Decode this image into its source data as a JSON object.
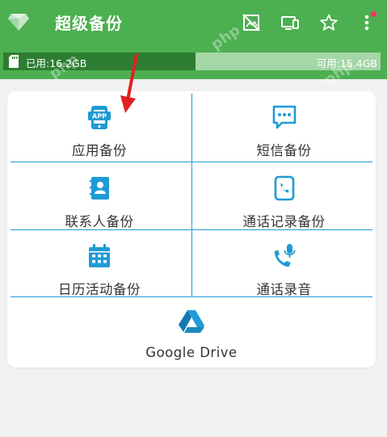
{
  "app": {
    "title": "超级备份"
  },
  "toolbar": {
    "icons": [
      "no-screenshot-icon",
      "cast-screen-icon",
      "star-icon",
      "more-vert-icon"
    ],
    "notification_dot_color": "#ff3366"
  },
  "storage": {
    "used_label": "已用:16.2GB",
    "free_label": "可用:15.4GB",
    "used_fraction": 0.51
  },
  "menu": {
    "items": [
      {
        "label": "应用备份",
        "icon": "app-backup-icon"
      },
      {
        "label": "短信备份",
        "icon": "sms-backup-icon"
      },
      {
        "label": "联系人备份",
        "icon": "contacts-backup-icon"
      },
      {
        "label": "通话记录备份",
        "icon": "call-log-backup-icon"
      },
      {
        "label": "日历活动备份",
        "icon": "calendar-backup-icon"
      },
      {
        "label": "通话录音",
        "icon": "call-recording-icon"
      },
      {
        "label": "Google Drive",
        "icon": "google-drive-icon"
      }
    ]
  },
  "colors": {
    "appbar": "#4caf50",
    "storage_used": "#2e7d32",
    "storage_free": "#a5d6a7",
    "accent": "#1e9bd6",
    "annotation_arrow": "#e02020"
  }
}
